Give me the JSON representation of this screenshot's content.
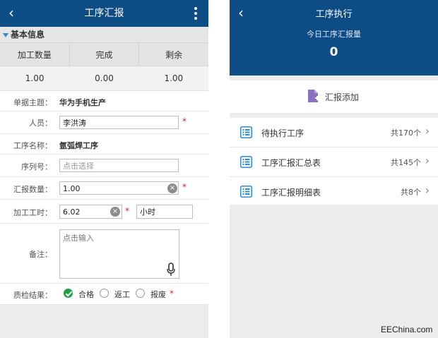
{
  "left_screen": {
    "title": "工序汇报",
    "back_icon": "‹",
    "section_title": "基本信息",
    "summary": {
      "headers": [
        "加工数量",
        "完成",
        "剩余"
      ],
      "values": [
        "1.00",
        "0.00",
        "1.00"
      ]
    },
    "form": {
      "subject_label": "单据主题：",
      "subject_value": "华为手机生产",
      "person_label": "人员：",
      "person_value": "李洪涛",
      "process_label": "工序名称：",
      "process_value": "氩弧焊工序",
      "serial_label": "序列号：",
      "serial_placeholder": "点击选择",
      "report_qty_label": "汇报数量：",
      "report_qty_value": "1.00",
      "hours_label": "加工工时：",
      "hours_value": "6.02",
      "hours_unit": "小时",
      "note_label": "备注：",
      "note_placeholder": "点击输入",
      "qc_label": "质检结果：",
      "qc_options": [
        "合格",
        "返工",
        "报废"
      ],
      "qc_selected": "合格",
      "required_mark": "*",
      "clear_glyph": "×"
    }
  },
  "right_screen": {
    "title": "工序执行",
    "back_icon": "‹",
    "today_label": "今日工序汇报量",
    "today_count": "0",
    "add_label": "汇报添加",
    "menu": [
      {
        "label": "待执行工序",
        "count": "共170个"
      },
      {
        "label": "工序汇报汇总表",
        "count": "共145个"
      },
      {
        "label": "工序汇报明细表",
        "count": "共8个"
      }
    ],
    "chevron": "›"
  },
  "watermark": "EEChina.com",
  "colors": {
    "header_blue": "#0e4c86",
    "accent_blue": "#2a8bd6",
    "required_red": "#e02020",
    "check_green": "#1e9e46",
    "doc_purple": "#8b6fc2"
  }
}
